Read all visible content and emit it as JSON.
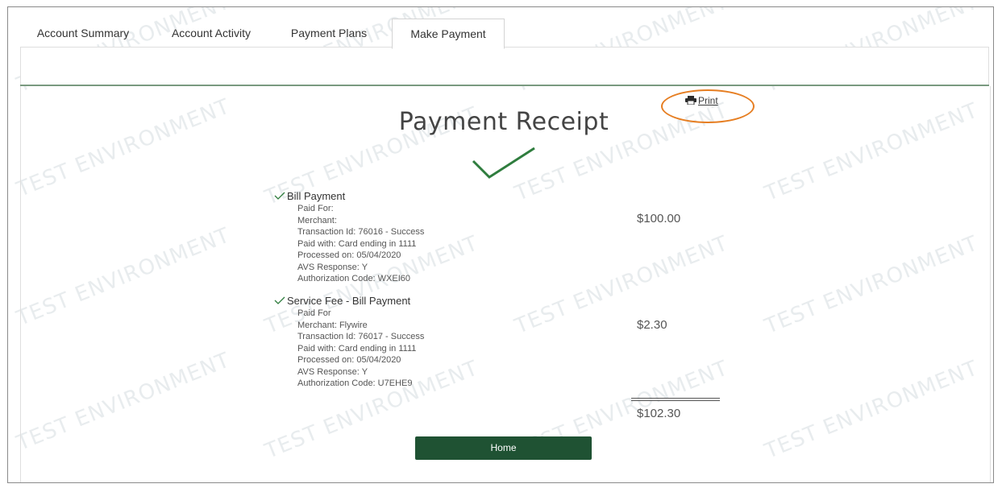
{
  "tabs": [
    {
      "label": "Account Summary",
      "active": false
    },
    {
      "label": "Account Activity",
      "active": false
    },
    {
      "label": "Payment Plans",
      "active": false
    },
    {
      "label": "Make Payment",
      "active": true
    }
  ],
  "print": {
    "label": "Print",
    "icon": "printer-icon"
  },
  "receipt": {
    "title": "Payment Receipt",
    "success_icon": "checkmark-icon",
    "items": [
      {
        "heading": "Bill Payment",
        "paid_for": "Paid For:",
        "merchant": "Merchant:",
        "transaction_id": "Transaction Id: 76016 - Success",
        "paid_with": "Paid with: Card ending in 1111",
        "processed_on": "Processed on: 05/04/2020",
        "avs_response": "AVS Response: Y",
        "authorization_code": "Authorization Code: WXEI60",
        "amount": "$100.00"
      },
      {
        "heading": "Service Fee - Bill Payment",
        "paid_for": "Paid For",
        "merchant": "Merchant: Flywire",
        "transaction_id": "Transaction Id: 76017 - Success",
        "paid_with": "Paid with: Card ending in 1111",
        "processed_on": "Processed on: 05/04/2020",
        "avs_response": "AVS Response: Y",
        "authorization_code": "Authorization Code: U7EHE9",
        "amount": "$2.30"
      }
    ],
    "total": "$102.30",
    "home_label": "Home"
  },
  "watermark": "TEST ENVIRONMENT",
  "colors": {
    "accent": "#1f5233",
    "check": "#2f7d3e",
    "highlight": "#e67e22"
  }
}
